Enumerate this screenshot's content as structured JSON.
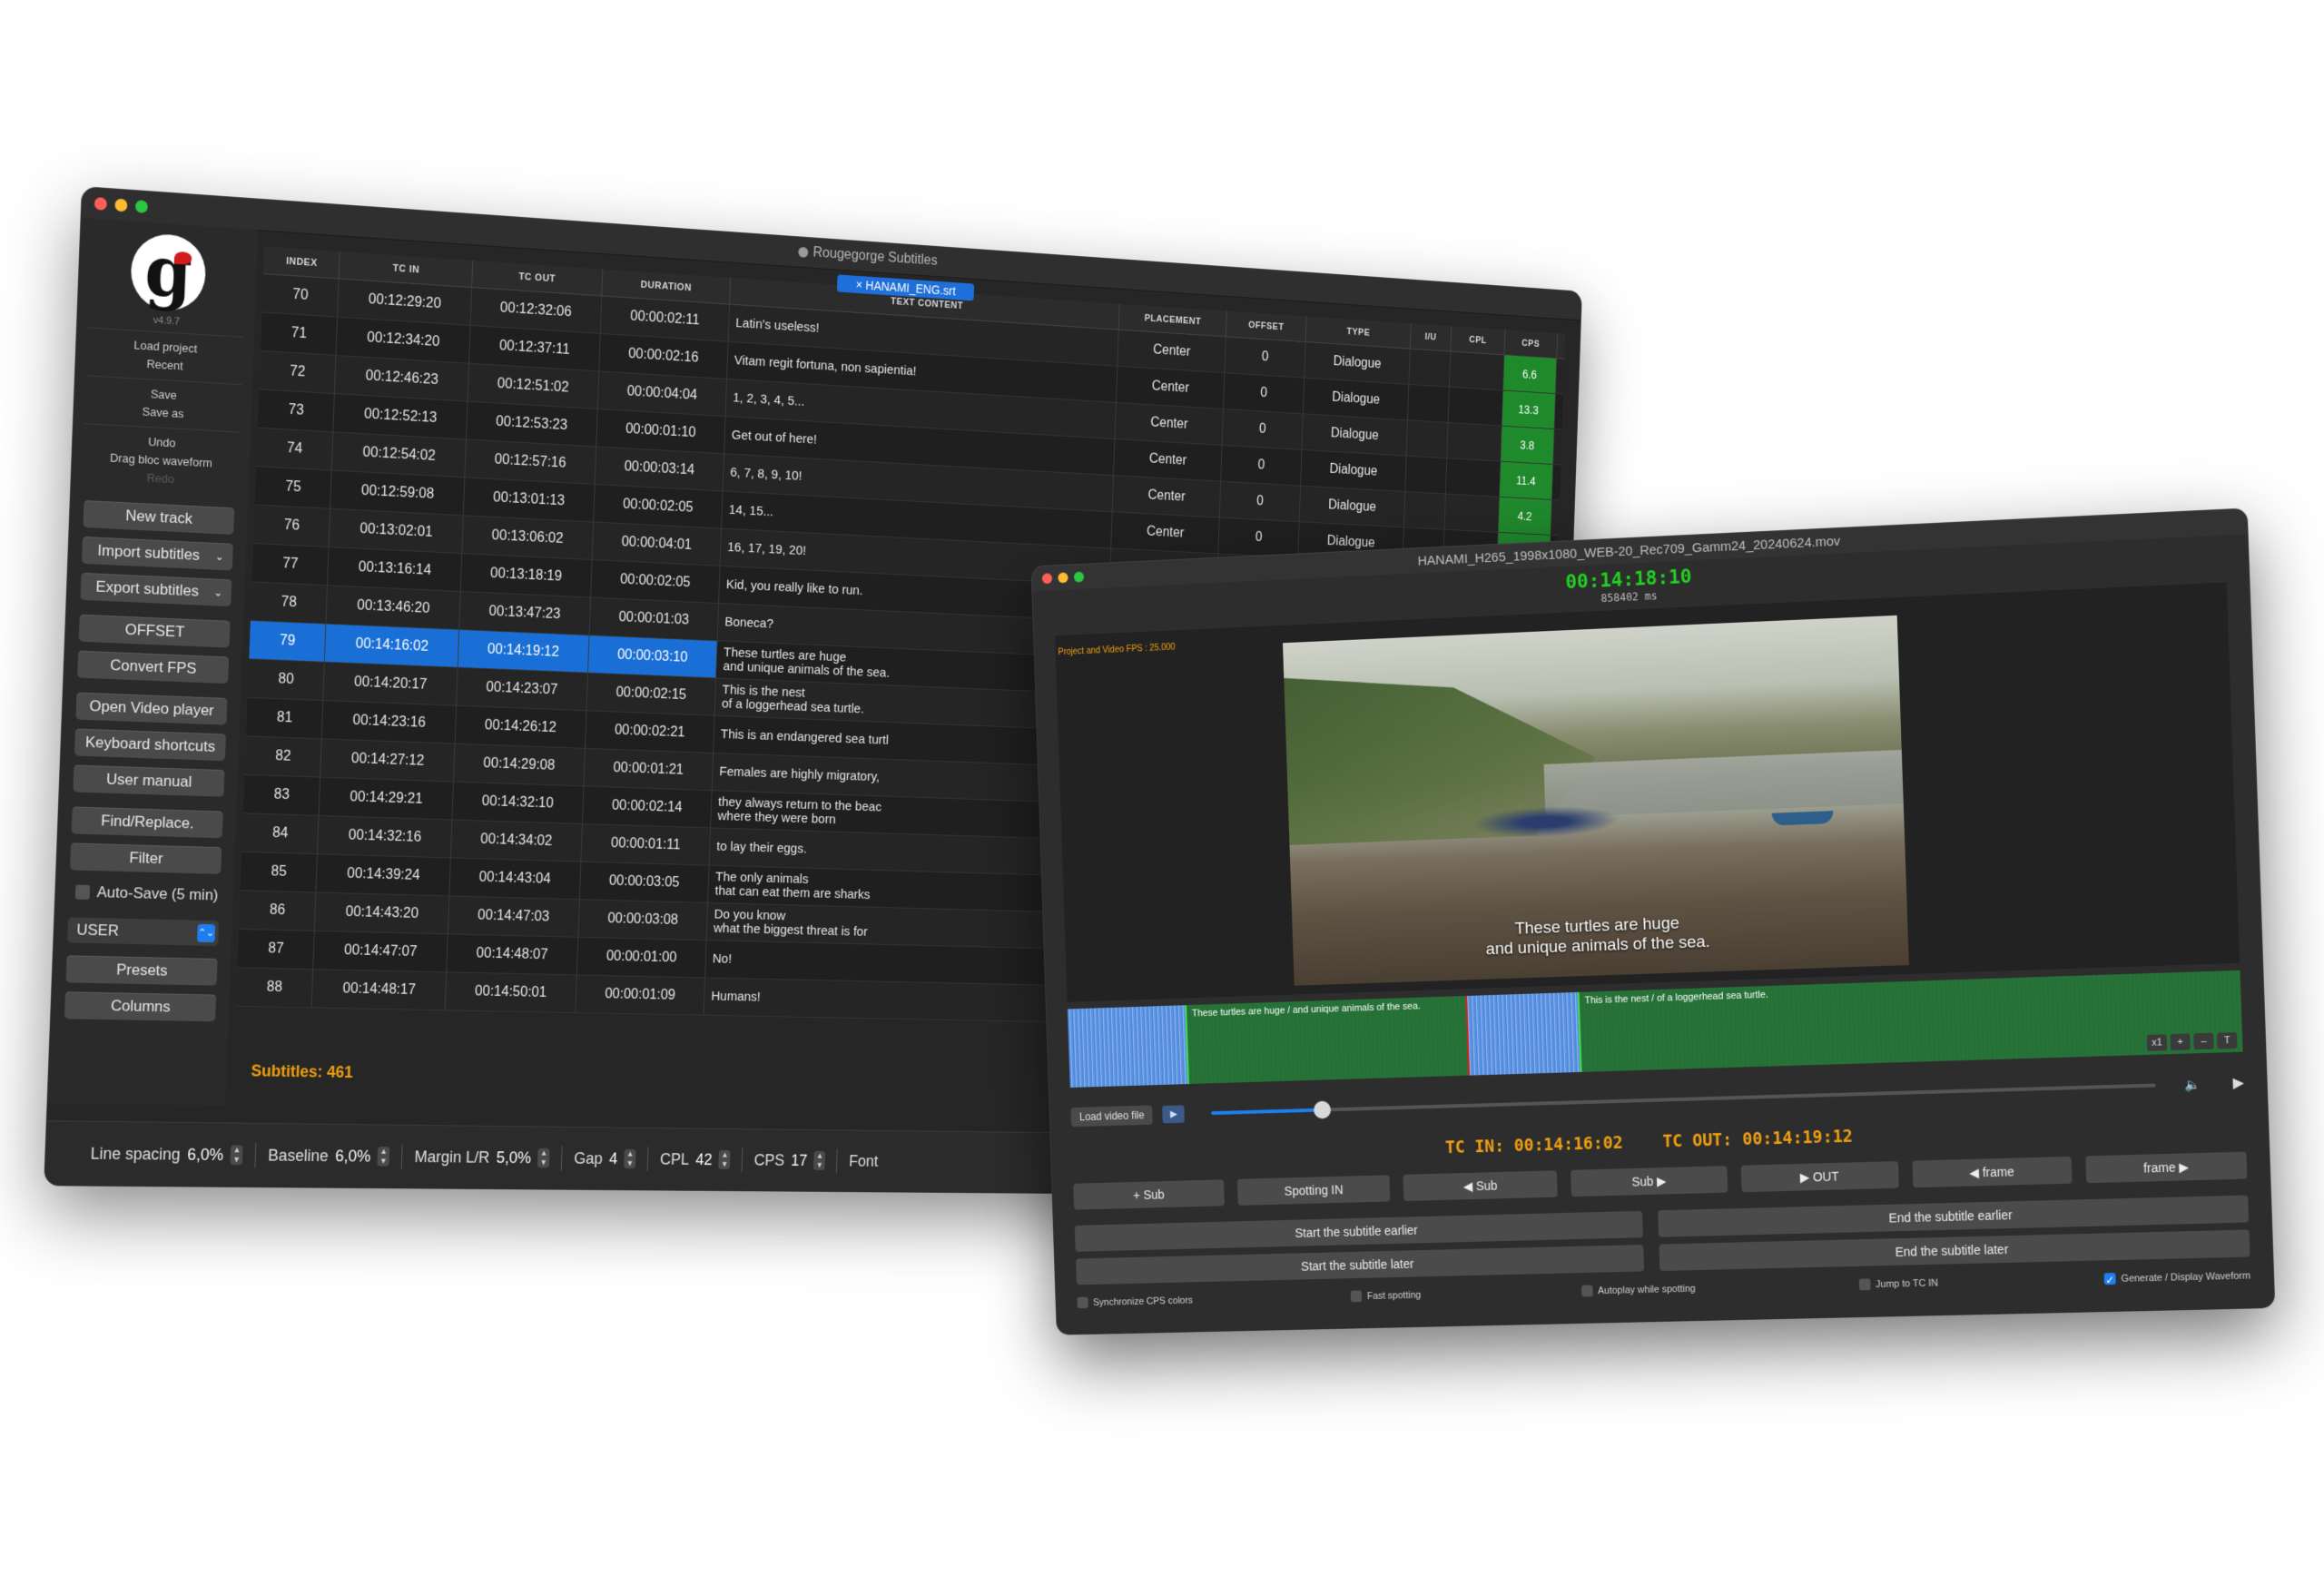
{
  "main": {
    "title": "Rougegorge Subtitles",
    "file_tab": "HANAMI_ENG.srt",
    "file_tab_close": "×",
    "version": "v4.9.7",
    "menu": {
      "load_project": "Load project",
      "recent": "Recent",
      "save": "Save",
      "save_as": "Save as",
      "undo": "Undo",
      "undo_detail": "Drag bloc waveform",
      "redo": "Redo"
    },
    "buttons": {
      "new_track": "New track",
      "import": "Import subtitles",
      "export": "Export subtitles",
      "offset": "OFFSET",
      "convert_fps": "Convert FPS",
      "open_video": "Open Video player",
      "shortcuts": "Keyboard shortcuts",
      "manual": "User manual",
      "find": "Find/Replace.",
      "filter": "Filter",
      "autosave": "Auto-Save (5 min)",
      "user_select": "USER",
      "presets": "Presets",
      "columns": "Columns"
    },
    "columns": [
      "INDEX",
      "TC IN",
      "TC OUT",
      "DURATION",
      "TEXT CONTENT",
      "PLACEMENT",
      "OFFSET",
      "TYPE",
      "I/U",
      "CPL",
      "CPS",
      "⚠"
    ],
    "rows": [
      {
        "index": "70",
        "tc_in": "00:12:29:20",
        "tc_out": "00:12:32:06",
        "duration": "00:00:02:11",
        "text": "Latin's useless!",
        "placement": "Center",
        "offset": "0",
        "type": "Dialogue",
        "cps": "6.6"
      },
      {
        "index": "71",
        "tc_in": "00:12:34:20",
        "tc_out": "00:12:37:11",
        "duration": "00:00:02:16",
        "text": "Vitam regit fortuna, non sapientia!",
        "placement": "Center",
        "offset": "0",
        "type": "Dialogue",
        "cps": "13.3"
      },
      {
        "index": "72",
        "tc_in": "00:12:46:23",
        "tc_out": "00:12:51:02",
        "duration": "00:00:04:04",
        "text": "1, 2, 3, 4, 5...",
        "placement": "Center",
        "offset": "0",
        "type": "Dialogue",
        "cps": "3.8"
      },
      {
        "index": "73",
        "tc_in": "00:12:52:13",
        "tc_out": "00:12:53:23",
        "duration": "00:00:01:10",
        "text": "Get out of here!",
        "placement": "Center",
        "offset": "0",
        "type": "Dialogue",
        "cps": "11.4"
      },
      {
        "index": "74",
        "tc_in": "00:12:54:02",
        "tc_out": "00:12:57:16",
        "duration": "00:00:03:14",
        "text": "6, 7, 8, 9, 10!",
        "placement": "Center",
        "offset": "0",
        "type": "Dialogue",
        "cps": "4.2"
      },
      {
        "index": "75",
        "tc_in": "00:12:59:08",
        "tc_out": "00:13:01:13",
        "duration": "00:00:02:05",
        "text": "14, 15...",
        "placement": "Center",
        "offset": "0",
        "type": "Dialogue",
        "cps": "4.1"
      },
      {
        "index": "76",
        "tc_in": "00:13:02:01",
        "tc_out": "00:13:06:02",
        "duration": "00:00:04:01",
        "text": "16, 17, 19, 20!",
        "placement": "Center",
        "offset": "0",
        "type": "Dialogue",
        "cps": ""
      },
      {
        "index": "77",
        "tc_in": "00:13:16:14",
        "tc_out": "00:13:18:19",
        "duration": "00:00:02:05",
        "text": "Kid, you really like to run.",
        "placement": "",
        "offset": "",
        "type": "",
        "cps": ""
      },
      {
        "index": "78",
        "tc_in": "00:13:46:20",
        "tc_out": "00:13:47:23",
        "duration": "00:00:01:03",
        "text": "Boneca?",
        "placement": "",
        "offset": "",
        "type": "",
        "cps": ""
      },
      {
        "index": "79",
        "tc_in": "00:14:16:02",
        "tc_out": "00:14:19:12",
        "duration": "00:00:03:10",
        "text": "These turtles are huge\nand unique animals of the sea.",
        "placement": "",
        "offset": "",
        "type": "",
        "cps": "",
        "selected": true
      },
      {
        "index": "80",
        "tc_in": "00:14:20:17",
        "tc_out": "00:14:23:07",
        "duration": "00:00:02:15",
        "text": "This is the nest\nof a loggerhead sea turtle.",
        "placement": "",
        "offset": "",
        "type": "",
        "cps": ""
      },
      {
        "index": "81",
        "tc_in": "00:14:23:16",
        "tc_out": "00:14:26:12",
        "duration": "00:00:02:21",
        "text": "This is an endangered sea turtl",
        "placement": "",
        "offset": "",
        "type": "",
        "cps": ""
      },
      {
        "index": "82",
        "tc_in": "00:14:27:12",
        "tc_out": "00:14:29:08",
        "duration": "00:00:01:21",
        "text": "Females are highly migratory,",
        "placement": "",
        "offset": "",
        "type": "",
        "cps": ""
      },
      {
        "index": "83",
        "tc_in": "00:14:29:21",
        "tc_out": "00:14:32:10",
        "duration": "00:00:02:14",
        "text": "they always return to the beac\nwhere they were born",
        "placement": "",
        "offset": "",
        "type": "",
        "cps": ""
      },
      {
        "index": "84",
        "tc_in": "00:14:32:16",
        "tc_out": "00:14:34:02",
        "duration": "00:00:01:11",
        "text": "to lay their eggs.",
        "placement": "",
        "offset": "",
        "type": "",
        "cps": ""
      },
      {
        "index": "85",
        "tc_in": "00:14:39:24",
        "tc_out": "00:14:43:04",
        "duration": "00:00:03:05",
        "text": "The only animals\nthat can eat them are sharks",
        "placement": "",
        "offset": "",
        "type": "",
        "cps": ""
      },
      {
        "index": "86",
        "tc_in": "00:14:43:20",
        "tc_out": "00:14:47:03",
        "duration": "00:00:03:08",
        "text": "Do you know\nwhat the biggest threat is for",
        "placement": "",
        "offset": "",
        "type": "",
        "cps": ""
      },
      {
        "index": "87",
        "tc_in": "00:14:47:07",
        "tc_out": "00:14:48:07",
        "duration": "00:00:01:00",
        "text": "No!",
        "placement": "",
        "offset": "",
        "type": "",
        "cps": ""
      },
      {
        "index": "88",
        "tc_in": "00:14:48:17",
        "tc_out": "00:14:50:01",
        "duration": "00:00:01:09",
        "text": "Humans!",
        "placement": "",
        "offset": "",
        "type": "",
        "cps": ""
      }
    ],
    "subtitles_count": "Subtitles: 461",
    "bottom": {
      "line_spacing_label": "Line spacing",
      "line_spacing": "6,0%",
      "baseline_label": "Baseline",
      "baseline": "6,0%",
      "margin_label": "Margin L/R",
      "margin": "5,0%",
      "gap_label": "Gap",
      "gap": "4",
      "cpl_label": "CPL",
      "cpl": "42",
      "cps_label": "CPS",
      "cps": "17",
      "font_label": "Font"
    },
    "cps_color": "#1f8a2c",
    "accent": "#1a6fd6"
  },
  "video": {
    "title": "HANAMI_H265_1998x1080_WEB-20_Rec709_Gamm24_20240624.mov",
    "timecode": "00:14:18:10",
    "ms": "858402 ms",
    "fps_note": "Project and Video FPS : 25.000",
    "subtitle_line1": "These turtles are huge",
    "subtitle_line2": "and unique animals of the sea.",
    "wave_label_1": "These turtles are huge / and unique animals of the sea.",
    "wave_label_2": "This is the nest / of a loggerhead sea turtle.",
    "wave_btns": [
      "x1",
      "+",
      "–",
      "T"
    ],
    "load_video": "Load video file",
    "tc_in_label": "TC IN:",
    "tc_in": "00:14:16:02",
    "tc_out_label": "TC OUT:",
    "tc_out": "00:14:19:12",
    "buttons": [
      "+ Sub",
      "Spotting IN",
      "◀ Sub",
      "Sub ▶",
      "▶ OUT",
      "◀ frame",
      "frame ▶"
    ],
    "buttons2": [
      "Start the subtitle earlier",
      "End the subtitle earlier",
      "Start the subtitle later",
      "End the subtitle later"
    ],
    "checks": [
      {
        "label": "Synchronize CPS colors",
        "on": false
      },
      {
        "label": "Fast spotting",
        "on": false
      },
      {
        "label": "Autoplay while spotting",
        "on": false
      },
      {
        "label": "Jump to TC IN",
        "on": false
      },
      {
        "label": "Generate / Display Waveform",
        "on": true
      }
    ],
    "timecode_color": "#22d022",
    "tc_color": "#f0a010",
    "slider_progress": 0.12
  }
}
